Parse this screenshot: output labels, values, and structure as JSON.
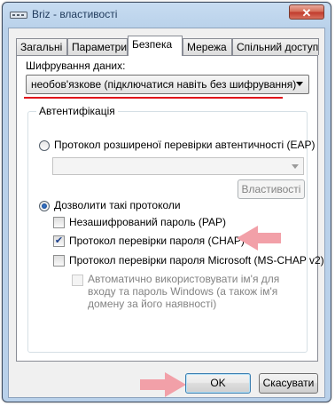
{
  "window": {
    "title": "Briz - властивості",
    "close_glyph": "✕"
  },
  "tabs": [
    {
      "label": "Загальні"
    },
    {
      "label": "Параметри"
    },
    {
      "label": "Безпека"
    },
    {
      "label": "Мережа"
    },
    {
      "label": "Спільний доступ"
    }
  ],
  "security": {
    "encryption_label": "Шифрування даних:",
    "encryption_value": "необов'язкове (підключатися навіть без шифрування)",
    "auth_group_label": "Автентифікація",
    "eap_radio_label": "Протокол розширеної перевірки автентичності (EAP)",
    "properties_button": "Властивості",
    "allow_radio_label": "Дозволити такі протоколи",
    "pap_label": "Незашифрований пароль (PAP)",
    "chap_label": "Протокол перевірки пароля (CHAP)",
    "mschap_label": "Протокол перевірки пароля Microsoft (MS-CHAP v2)",
    "auto_windows_label": "Автоматично використовувати ім'я для входу та пароль Windows (а також ім'я домену за його наявності)"
  },
  "buttons": {
    "ok": "OK",
    "cancel": "Скасувати"
  },
  "state": {
    "selected_tab": "Безпека",
    "eap_selected": false,
    "allow_selected": true,
    "pap_checked": false,
    "chap_checked": true,
    "mschap_checked": false,
    "auto_windows_checked": false
  },
  "colors": {
    "annotation_red": "#e0101a",
    "annotation_arrow": "#f2a0a8"
  }
}
